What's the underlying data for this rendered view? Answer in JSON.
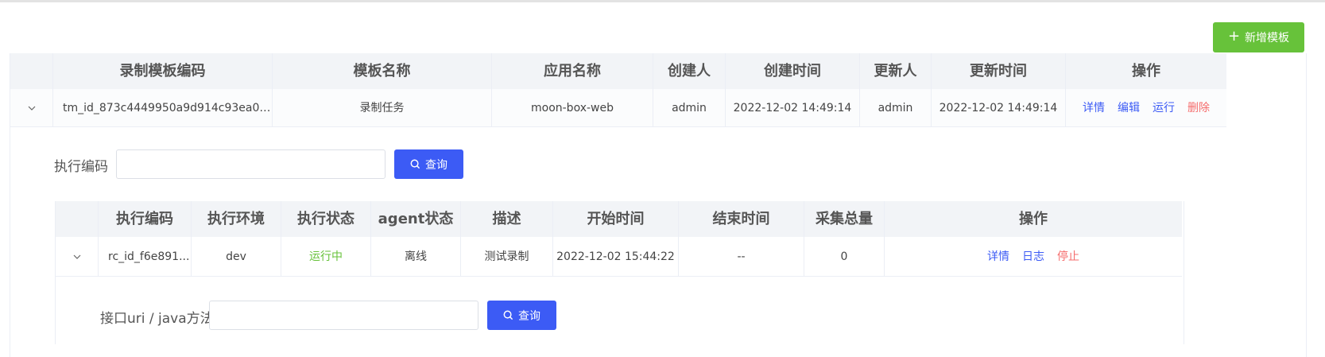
{
  "toolbar": {
    "add_label": "新增模板"
  },
  "main_table": {
    "columns": [
      "录制模板编码",
      "模板名称",
      "应用名称",
      "创建人",
      "创建时间",
      "更新人",
      "更新时间",
      "操作"
    ],
    "row": {
      "code": "tm_id_873c4449950a9d914c93ea075c...",
      "name": "录制任务",
      "app": "moon-box-web",
      "creator": "admin",
      "created": "2022-12-02 14:49:14",
      "updater": "admin",
      "updated": "2022-12-02 14:49:14",
      "actions": [
        "详情",
        "编辑",
        "运行",
        "删除"
      ]
    }
  },
  "exec_search": {
    "label": "执行编码",
    "value": "",
    "button": "查询"
  },
  "exec_table": {
    "columns": [
      "执行编码",
      "执行环境",
      "执行状态",
      "agent状态",
      "描述",
      "开始时间",
      "结束时间",
      "采集总量",
      "操作"
    ],
    "row": {
      "code": "rc_id_f6e891...",
      "env": "dev",
      "status": "运行中",
      "agent": "离线",
      "desc": "测试录制",
      "start": "2022-12-02 15:44:22",
      "end": "--",
      "total": "0",
      "actions": [
        "详情",
        "日志",
        "停止"
      ]
    }
  },
  "uri_search": {
    "label": "接口uri / java方法",
    "value": "",
    "button": "查询"
  },
  "colors": {
    "primary": "#3c5bf5",
    "success": "#67c23a",
    "danger": "#f56c6c"
  }
}
